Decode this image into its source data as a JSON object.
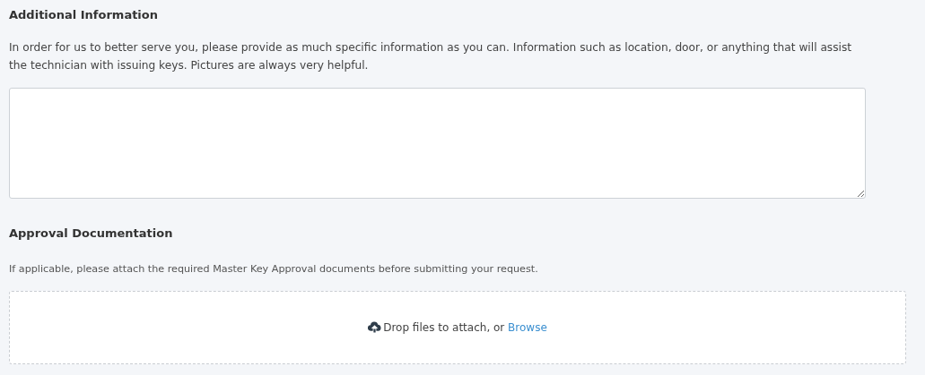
{
  "additional_information": {
    "heading": "Additional Information",
    "description": "In order for us to better serve you, please provide as much specific information as you can. Information such as location, door, or anything that will assist the technician with issuing keys. Pictures are always very helpful."
  },
  "approval_documentation": {
    "heading": "Approval Documentation",
    "description": "If applicable, please attach the required Master Key Approval documents before submitting your request.",
    "dropzone": {
      "text": "Drop files to attach, or",
      "link": "Browse"
    }
  }
}
